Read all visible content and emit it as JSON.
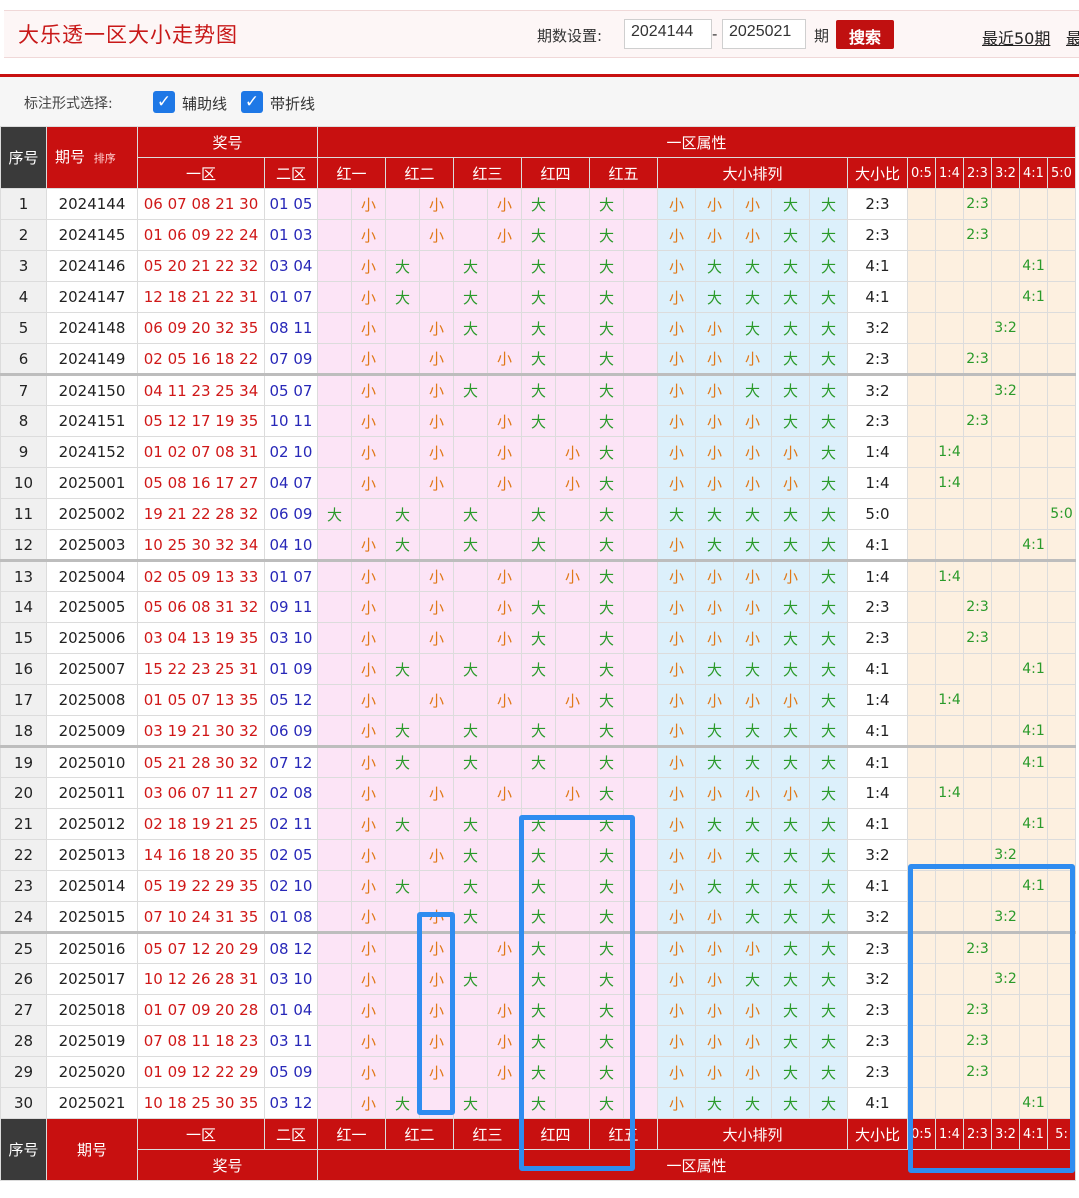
{
  "header": {
    "title": "大乐透一区大小走势图",
    "period_label": "期数设置:",
    "from": "2024144",
    "to": "2025021",
    "qi": "期",
    "search": "搜索",
    "recent50": "最近50期",
    "recent_more": "最"
  },
  "markbar": {
    "label": "标注形式选择:",
    "opt1": "辅助线",
    "opt2": "带折线"
  },
  "colors": {
    "accent": "#c81010",
    "small": "#e07818",
    "big": "#2a9a2a",
    "highlight_box": "#2f8cf0"
  },
  "table_head": {
    "seq": "序号",
    "period": "期号",
    "sort": "排序",
    "prize": "奖号",
    "zone1": "一区",
    "zone2": "二区",
    "attr": "一区属性",
    "reds": [
      "红一",
      "红二",
      "红三",
      "红四",
      "红五"
    ],
    "arrange": "大小排列",
    "ratio": "大小比",
    "ratios": [
      "0:5",
      "1:4",
      "2:3",
      "3:2",
      "4:1",
      "5:0"
    ],
    "ratios_foot": [
      "0:5",
      "1:4",
      "2:3",
      "3:2",
      "4:1",
      "5:"
    ]
  },
  "rows": [
    {
      "seq": "1",
      "period": "2024144",
      "z1": "06 07 08 21 30",
      "z2": "01 05",
      "pat": "SSSBB",
      "ratio": "2:3"
    },
    {
      "seq": "2",
      "period": "2024145",
      "z1": "01 06 09 22 24",
      "z2": "01 03",
      "pat": "SSSBB",
      "ratio": "2:3"
    },
    {
      "seq": "3",
      "period": "2024146",
      "z1": "05 20 21 22 32",
      "z2": "03 04",
      "pat": "SBBBB",
      "ratio": "4:1"
    },
    {
      "seq": "4",
      "period": "2024147",
      "z1": "12 18 21 22 31",
      "z2": "01 07",
      "pat": "SBBBB",
      "ratio": "4:1"
    },
    {
      "seq": "5",
      "period": "2024148",
      "z1": "06 09 20 32 35",
      "z2": "08 11",
      "pat": "SSBBB",
      "ratio": "3:2"
    },
    {
      "seq": "6",
      "period": "2024149",
      "z1": "02 05 16 18 22",
      "z2": "07 09",
      "pat": "SSSBB",
      "ratio": "2:3"
    },
    {
      "seq": "7",
      "period": "2024150",
      "z1": "04 11 23 25 34",
      "z2": "05 07",
      "pat": "SSBBB",
      "ratio": "3:2"
    },
    {
      "seq": "8",
      "period": "2024151",
      "z1": "05 12 17 19 35",
      "z2": "10 11",
      "pat": "SSSBB",
      "ratio": "2:3"
    },
    {
      "seq": "9",
      "period": "2024152",
      "z1": "01 02 07 08 31",
      "z2": "02 10",
      "pat": "SSSSB",
      "ratio": "1:4"
    },
    {
      "seq": "10",
      "period": "2025001",
      "z1": "05 08 16 17 27",
      "z2": "04 07",
      "pat": "SSSSB",
      "ratio": "1:4"
    },
    {
      "seq": "11",
      "period": "2025002",
      "z1": "19 21 22 28 32",
      "z2": "06 09",
      "pat": "BBBBB",
      "ratio": "5:0"
    },
    {
      "seq": "12",
      "period": "2025003",
      "z1": "10 25 30 32 34",
      "z2": "04 10",
      "pat": "SBBBB",
      "ratio": "4:1"
    },
    {
      "seq": "13",
      "period": "2025004",
      "z1": "02 05 09 13 33",
      "z2": "01 07",
      "pat": "SSSSB",
      "ratio": "1:4"
    },
    {
      "seq": "14",
      "period": "2025005",
      "z1": "05 06 08 31 32",
      "z2": "09 11",
      "pat": "SSSBB",
      "ratio": "2:3"
    },
    {
      "seq": "15",
      "period": "2025006",
      "z1": "03 04 13 19 35",
      "z2": "03 10",
      "pat": "SSSBB",
      "ratio": "2:3"
    },
    {
      "seq": "16",
      "period": "2025007",
      "z1": "15 22 23 25 31",
      "z2": "01 09",
      "pat": "SBBBB",
      "ratio": "4:1"
    },
    {
      "seq": "17",
      "period": "2025008",
      "z1": "01 05 07 13 35",
      "z2": "05 12",
      "pat": "SSSSB",
      "ratio": "1:4"
    },
    {
      "seq": "18",
      "period": "2025009",
      "z1": "03 19 21 30 32",
      "z2": "06 09",
      "pat": "SBBBB",
      "ratio": "4:1"
    },
    {
      "seq": "19",
      "period": "2025010",
      "z1": "05 21 28 30 32",
      "z2": "07 12",
      "pat": "SBBBB",
      "ratio": "4:1"
    },
    {
      "seq": "20",
      "period": "2025011",
      "z1": "03 06 07 11 27",
      "z2": "02 08",
      "pat": "SSSSB",
      "ratio": "1:4"
    },
    {
      "seq": "21",
      "period": "2025012",
      "z1": "02 18 19 21 25",
      "z2": "02 11",
      "pat": "SBBBB",
      "ratio": "4:1"
    },
    {
      "seq": "22",
      "period": "2025013",
      "z1": "14 16 18 20 35",
      "z2": "02 05",
      "pat": "SSBBB",
      "ratio": "3:2"
    },
    {
      "seq": "23",
      "period": "2025014",
      "z1": "05 19 22 29 35",
      "z2": "02 10",
      "pat": "SBBBB",
      "ratio": "4:1"
    },
    {
      "seq": "24",
      "period": "2025015",
      "z1": "07 10 24 31 35",
      "z2": "01 08",
      "pat": "SSBBB",
      "ratio": "3:2"
    },
    {
      "seq": "25",
      "period": "2025016",
      "z1": "05 07 12 20 29",
      "z2": "08 12",
      "pat": "SSSBB",
      "ratio": "2:3"
    },
    {
      "seq": "26",
      "period": "2025017",
      "z1": "10 12 26 28 31",
      "z2": "03 10",
      "pat": "SSBBB",
      "ratio": "3:2"
    },
    {
      "seq": "27",
      "period": "2025018",
      "z1": "01 07 09 20 28",
      "z2": "01 04",
      "pat": "SSSBB",
      "ratio": "2:3"
    },
    {
      "seq": "28",
      "period": "2025019",
      "z1": "07 08 11 18 23",
      "z2": "03 11",
      "pat": "SSSBB",
      "ratio": "2:3"
    },
    {
      "seq": "29",
      "period": "2025020",
      "z1": "01 09 12 22 29",
      "z2": "05 09",
      "pat": "SSSBB",
      "ratio": "2:3"
    },
    {
      "seq": "30",
      "period": "2025021",
      "z1": "10 18 25 30 35",
      "z2": "03 12",
      "pat": "SBBBB",
      "ratio": "4:1"
    }
  ],
  "labels": {
    "small": "小",
    "big": "大"
  }
}
